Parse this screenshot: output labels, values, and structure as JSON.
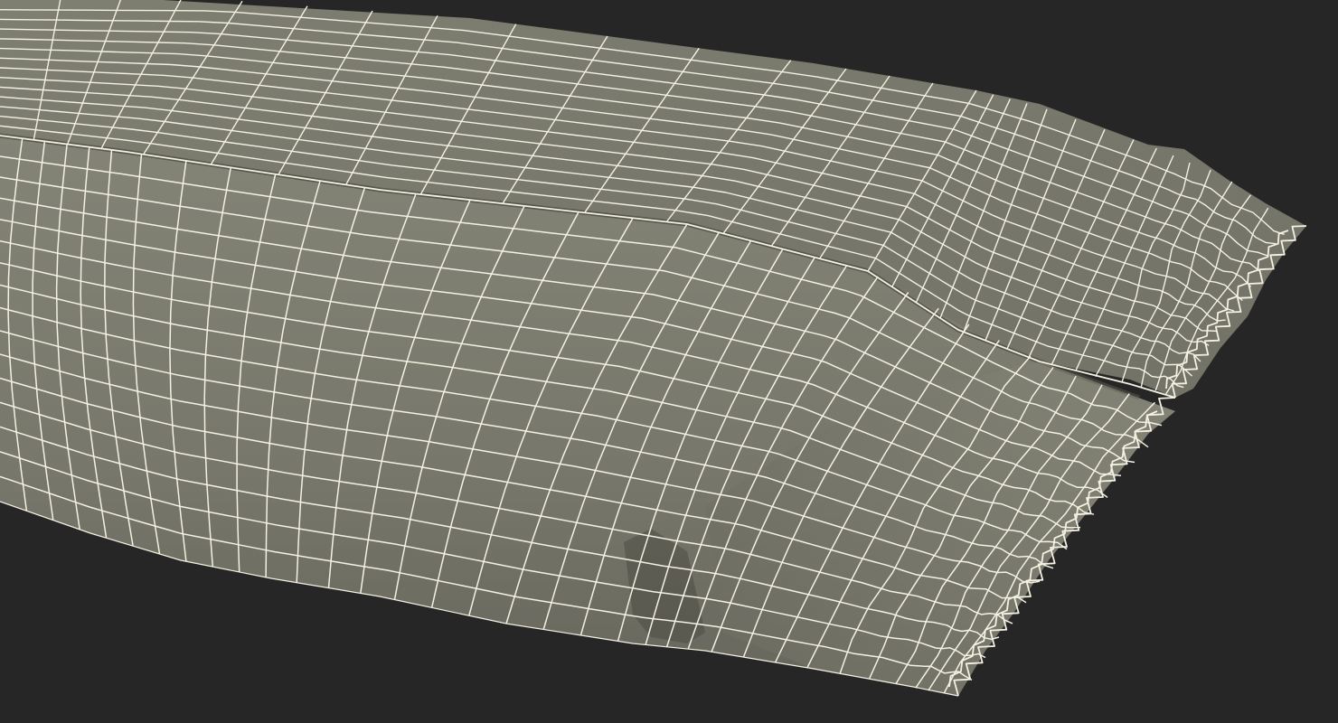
{
  "scene": {
    "subject": "wrapped-bar-wireframe-render",
    "colors": {
      "background": "#262626",
      "surface": "#7b7b6e",
      "surface_dark": "#5f5f55",
      "surface_shadow": "#4a4a42",
      "wire": "#f4f1e2"
    }
  }
}
